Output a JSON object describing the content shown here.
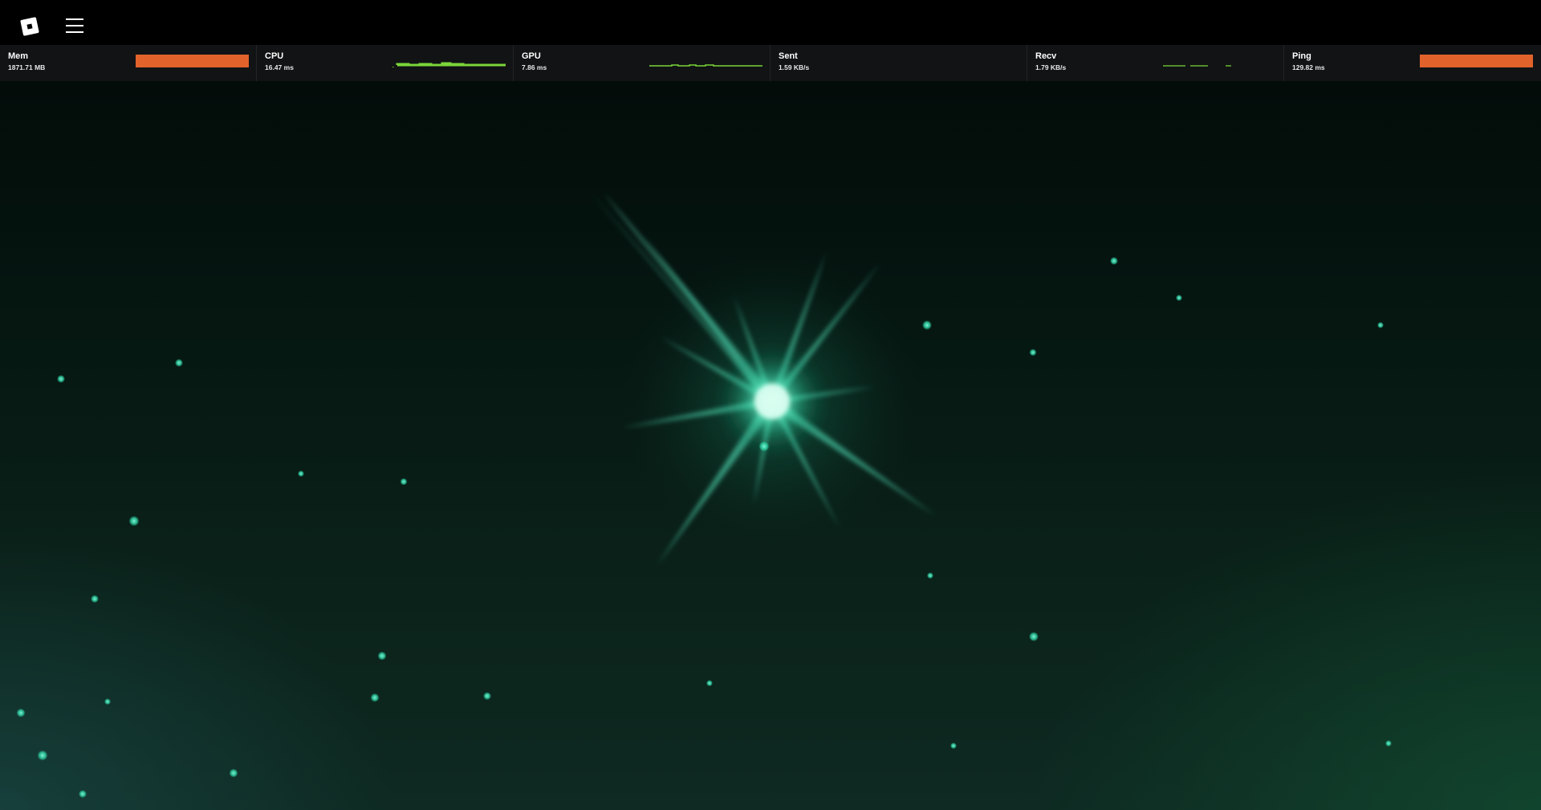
{
  "topbar": {
    "logo_icon": "roblox-logo-icon",
    "menu_icon": "hamburger-menu-icon"
  },
  "stats": [
    {
      "key": "mem",
      "label": "Mem",
      "value": "1871.71 MB",
      "display": "bar",
      "level": 1.0,
      "color": "#e2622c"
    },
    {
      "key": "cpu",
      "label": "CPU",
      "value": "16.47 ms",
      "display": "graph",
      "color": "#7bd63a"
    },
    {
      "key": "gpu",
      "label": "GPU",
      "value": "7.86 ms",
      "display": "graph",
      "color": "#7bd63a"
    },
    {
      "key": "sent",
      "label": "Sent",
      "value": "1.59 KB/s",
      "display": "graph",
      "color": "#7bd63a"
    },
    {
      "key": "recv",
      "label": "Recv",
      "value": "1.79 KB/s",
      "display": "graph",
      "color": "#7bd63a"
    },
    {
      "key": "ping",
      "label": "Ping",
      "value": "129.82 ms",
      "display": "bar",
      "level": 1.0,
      "color": "#e2622c"
    }
  ],
  "scene": {
    "glow_color": "#3ff0c0",
    "background_color": "#051510"
  }
}
